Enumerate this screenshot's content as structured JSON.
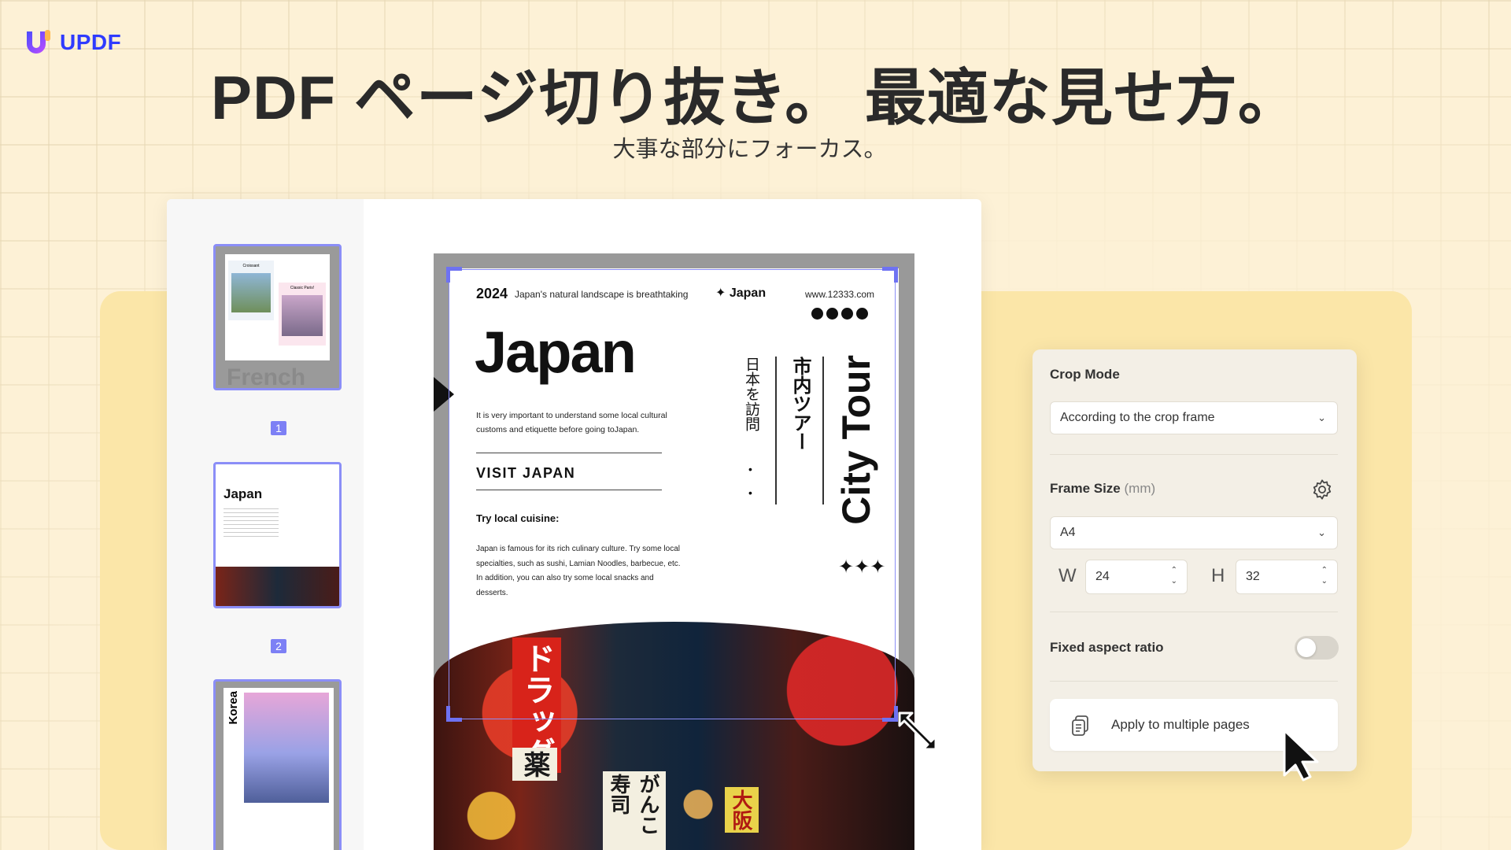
{
  "brand": {
    "name": "UPDF",
    "color": "#2f3bff"
  },
  "hero": {
    "title": "PDF ページ切り抜き。 最適な見せ方。",
    "subtitle": "大事な部分にフォーカス。"
  },
  "thumbnails": [
    {
      "number": "1",
      "label": "French",
      "card1": "Croissant",
      "card2": "Classic Paris!"
    },
    {
      "number": "2",
      "label": "Japan"
    },
    {
      "number": "",
      "label": "Korea"
    }
  ],
  "page": {
    "year": "2024",
    "tagline": "Japan's natural landscape is breathtaking",
    "brand": "✦ Japan",
    "url": "www.12333.com",
    "title": "Japan",
    "intro": "It is very important to understand some local cultural customs and etiquette before going toJapan.",
    "visit": "VISIT JAPAN",
    "try": "Try local cuisine:",
    "body": "Japan is famous for its rich culinary culture. Try some local specialties, such as sushi, Lamian Noodles, barbecue, etc. In addition, you can also try some local snacks and desserts.",
    "vertical_visit": "日本を訪問",
    "vertical_tour_jp": "市内ツアー",
    "vertical_tour": "City Tour",
    "sparkles": "✦✦✦",
    "photo_signs": [
      "ドラッグ",
      "薬",
      "がんこ寿司",
      "大阪"
    ]
  },
  "crop_panel": {
    "crop_mode_label": "Crop Mode",
    "crop_mode_value": "According to the crop frame",
    "frame_size_label": "Frame Size",
    "frame_size_unit": "(mm)",
    "frame_size_value": "A4",
    "w_label": "W",
    "w_value": "24",
    "h_label": "H",
    "h_value": "32",
    "aspect_label": "Fixed aspect ratio",
    "aspect_on": false,
    "apply_label": "Apply to multiple pages"
  },
  "icons": {
    "chevron": "chevron-down-icon",
    "settings": "gear-icon",
    "apply": "copy-pages-icon",
    "pointer": "mouse-pointer-icon",
    "resize": "resize-diagonal-icon"
  },
  "colors": {
    "accent": "#7d80f5",
    "background": "#fdf1d6",
    "block": "#fbe6a8"
  }
}
